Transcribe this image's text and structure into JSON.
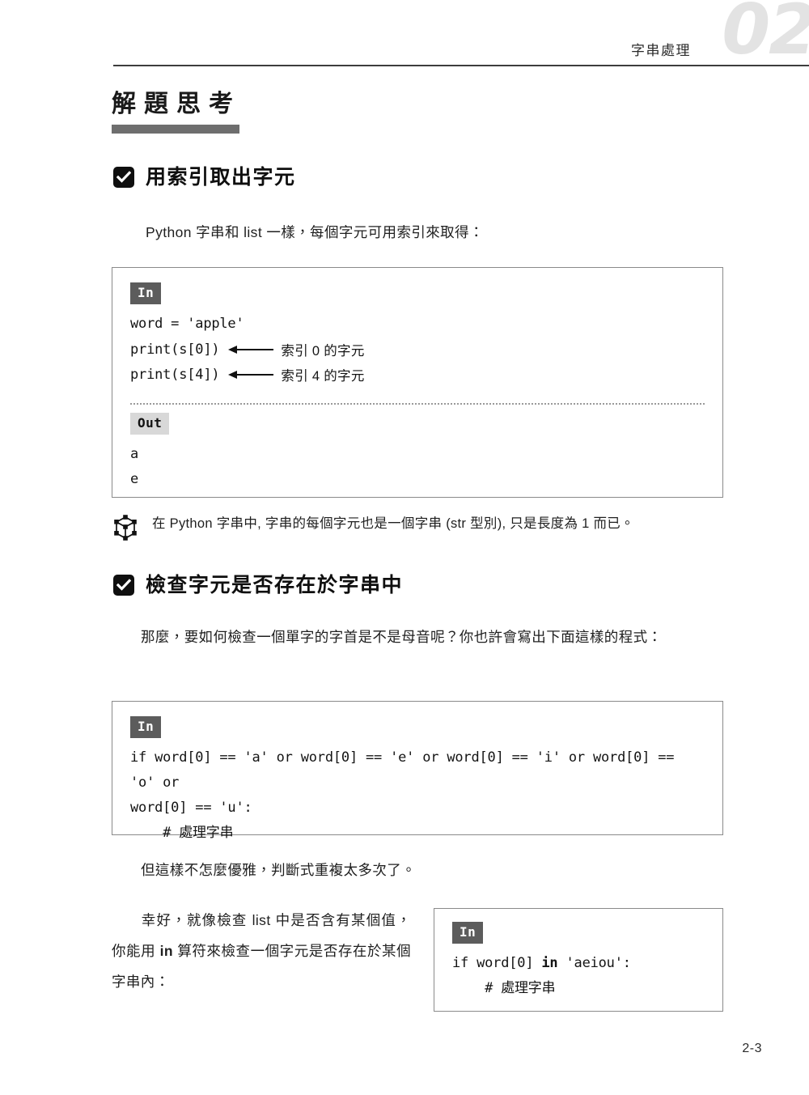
{
  "header": {
    "chapter_number": "02",
    "chapter_title": "字串處理"
  },
  "section": {
    "title": "解題思考"
  },
  "subsections": [
    {
      "label": "用索引取出字元",
      "icon": "checkbox-checked-icon"
    },
    {
      "label": "檢查字元是否存在於字串中",
      "icon": "checkbox-checked-icon"
    }
  ],
  "paragraphs": {
    "intro": "Python 字串和 list 一樣，每個字元可用索引來取得：",
    "vowel_question": "那麼，要如何檢查一個單字的字首是不是母音呢？你也許會寫出下面這樣的程式：",
    "not_elegant": "但這樣不怎麼優雅，判斷式重複太多次了。",
    "in_operator_a": "幸好，就像檢查 list 中是否含有某個值，你能用 ",
    "in_operator_bold": "in",
    "in_operator_b": " 算符來檢查一個字元是否存在於某個字串內："
  },
  "code_block_1": {
    "in_badge": "In",
    "out_badge": "Out",
    "lines": [
      "word = 'apple'"
    ],
    "annotated_lines": [
      {
        "code": "print(s[0])",
        "arrow": "left-arrow-icon",
        "note": "索引 0 的字元"
      },
      {
        "code": "print(s[4])",
        "arrow": "left-arrow-icon",
        "note": "索引 4 的字元"
      }
    ],
    "output_lines": [
      "a",
      "e"
    ]
  },
  "note": {
    "icon": "cube-wireframe-icon",
    "text": "在 Python 字串中, 字串的每個字元也是一個字串 (str 型別), 只是長度為 1 而已。"
  },
  "code_block_2": {
    "in_badge": "In",
    "line_1": "if word[0] == 'a' or word[0] == 'e' or word[0] == 'i' or word[0] == 'o' or",
    "line_2": "word[0] == 'u':",
    "line_3": "    # 處理字串"
  },
  "code_block_3": {
    "in_badge": "In",
    "line_1_a": "if word[0] ",
    "line_1_bold": "in",
    "line_1_b": " 'aeiou':",
    "line_2": "    # 處理字串"
  },
  "footer": {
    "page_number": "2-3"
  },
  "colors": {
    "badge_in_bg": "#5c5c5c",
    "badge_out_bg": "#d8d8d8",
    "section_bar": "#6e6e6e",
    "chapter_number": "#e3e3e3",
    "box_border": "#8a8a8a"
  }
}
